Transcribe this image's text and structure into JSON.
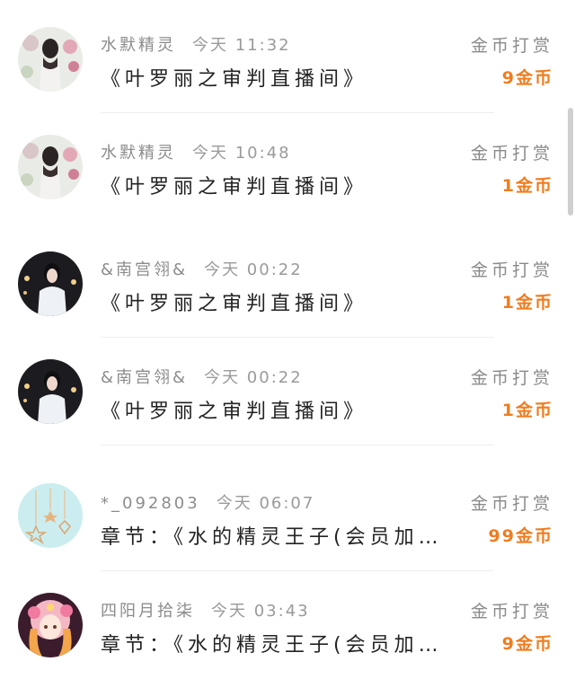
{
  "items": [
    {
      "name": "水默精灵",
      "time": "今天 11:32",
      "title": "《叶罗丽之审判直播间》",
      "action": "金币打赏",
      "coins": "9金币",
      "avatar": "woman-roses"
    },
    {
      "name": "水默精灵",
      "time": "今天 10:48",
      "title": "《叶罗丽之审判直播间》",
      "action": "金币打赏",
      "coins": "1金币",
      "avatar": "woman-roses"
    },
    {
      "name": "&南宫翎&",
      "time": "今天 00:22",
      "title": "《叶罗丽之审判直播间》",
      "action": "金币打赏",
      "coins": "1金币",
      "avatar": "woman-dark"
    },
    {
      "name": "&南宫翎&",
      "time": "今天 00:22",
      "title": "《叶罗丽之审判直播间》",
      "action": "金币打赏",
      "coins": "1金币",
      "avatar": "woman-dark"
    },
    {
      "name": "*_092803",
      "time": "今天 06:07",
      "title": "章节：《水的精灵王子(会员加…",
      "action": "金币打赏",
      "coins": "99金币",
      "avatar": "teal-stars"
    },
    {
      "name": "四阳月拾柒",
      "time": "今天 03:43",
      "title": "章节：《水的精灵王子(会员加…",
      "action": "金币打赏",
      "coins": "9金币",
      "avatar": "anime-pink"
    }
  ],
  "colors": {
    "coin": "#f07c1e",
    "meta": "#8c8c8c",
    "title": "#222222"
  }
}
